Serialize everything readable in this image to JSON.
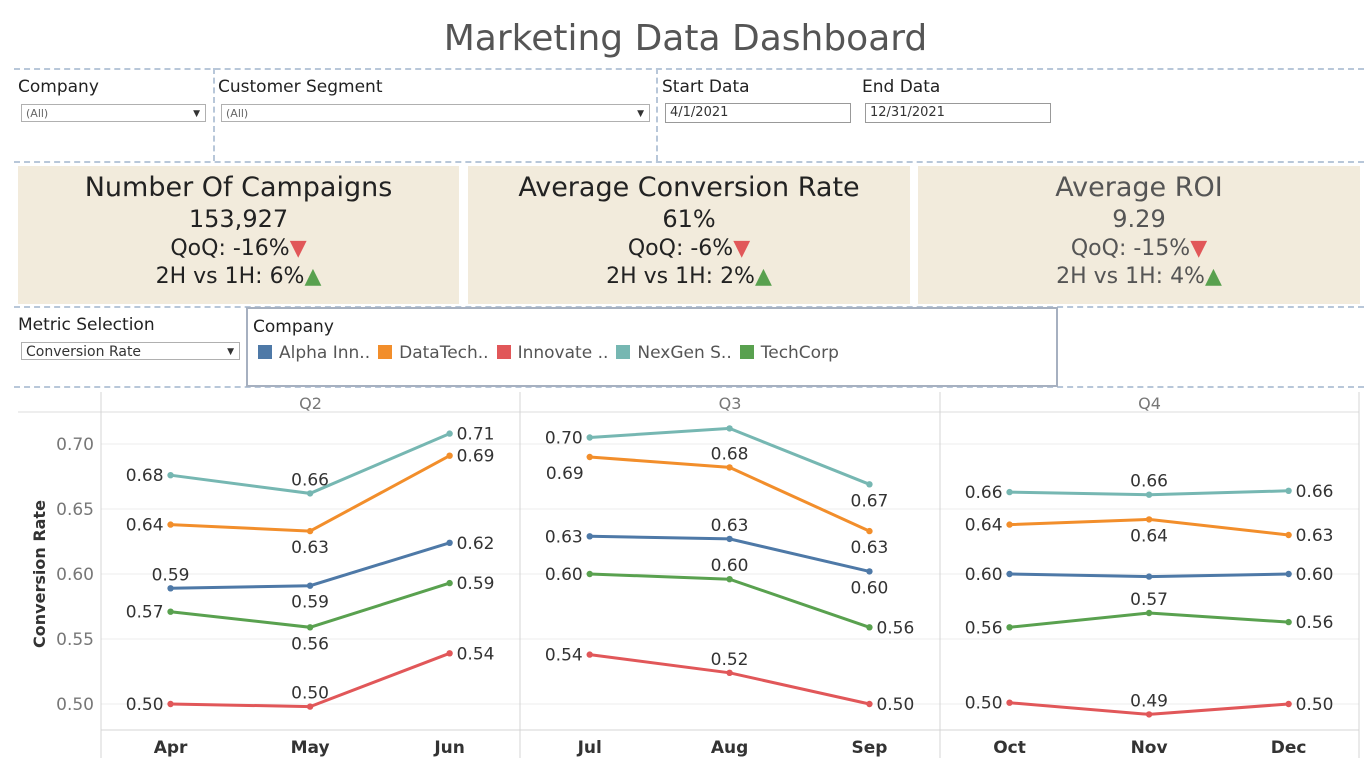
{
  "title": "Marketing Data Dashboard",
  "filters": {
    "company_label": "Company",
    "company_value": "(All)",
    "segment_label": "Customer Segment",
    "segment_value": "(All)",
    "start_label": "Start Data",
    "start_value": "4/1/2021",
    "end_label": "End Data",
    "end_value": "12/31/2021"
  },
  "kpis": [
    {
      "title": "Number Of Campaigns",
      "value": "153,927",
      "qoq": "QoQ: -16%",
      "qoq_dir": "down",
      "hvh": "2H vs 1H: 6%",
      "hvh_dir": "up"
    },
    {
      "title": "Average Conversion Rate",
      "value": "61%",
      "qoq": "QoQ: -6%",
      "qoq_dir": "down",
      "hvh": "2H vs 1H: 2%",
      "hvh_dir": "up"
    },
    {
      "title": "Average ROI",
      "value": "9.29",
      "qoq": "QoQ: -15%",
      "qoq_dir": "down",
      "hvh": "2H vs 1H: 4%",
      "hvh_dir": "up"
    }
  ],
  "metric": {
    "label": "Metric Selection",
    "value": "Conversion Rate"
  },
  "legend": {
    "title": "Company",
    "items": [
      {
        "label": "Alpha Inn..",
        "color": "#4e79a7"
      },
      {
        "label": "DataTech..",
        "color": "#f28e2b"
      },
      {
        "label": "Innovate ..",
        "color": "#e15759"
      },
      {
        "label": "NexGen S..",
        "color": "#76b7b2"
      },
      {
        "label": "TechCorp",
        "color": "#59a14f"
      }
    ]
  },
  "colors": {
    "down": "#e15759",
    "up": "#59a14f",
    "kpi_bg": "#f2ebdc"
  },
  "chart_data": {
    "type": "line",
    "ylabel": "Conversion Rate",
    "ylim": [
      0.48,
      0.72
    ],
    "yticks": [
      "0.50",
      "0.55",
      "0.60",
      "0.65",
      "0.70"
    ],
    "grid": true,
    "panels": [
      {
        "label": "Q2",
        "months": [
          "Apr",
          "May",
          "Jun"
        ]
      },
      {
        "label": "Q3",
        "months": [
          "Jul",
          "Aug",
          "Sep"
        ]
      },
      {
        "label": "Q4",
        "months": [
          "Oct",
          "Nov",
          "Dec"
        ]
      }
    ],
    "series": [
      {
        "name": "Alpha Inn..",
        "color": "#4e79a7",
        "values": [
          0.589,
          0.591,
          0.624,
          0.629,
          0.627,
          0.602,
          0.6,
          0.598,
          0.6
        ],
        "labels": [
          "0.59",
          "0.59",
          "0.62",
          "0.63",
          "0.63",
          "0.60",
          "0.60",
          "",
          "0.60"
        ],
        "pos": [
          "a",
          "b",
          "r",
          "l",
          "a",
          "b",
          "l",
          "",
          "r"
        ]
      },
      {
        "name": "DataTech..",
        "color": "#f28e2b",
        "values": [
          0.638,
          0.633,
          0.691,
          0.69,
          0.682,
          0.633,
          0.638,
          0.642,
          0.63
        ],
        "labels": [
          "0.64",
          "0.63",
          "0.69",
          "0.69",
          "0.68",
          "0.63",
          "0.64",
          "0.64",
          "0.63"
        ],
        "pos": [
          "l",
          "b",
          "r",
          "bl",
          "a",
          "b",
          "l",
          "b",
          "r"
        ]
      },
      {
        "name": "Innovate ..",
        "color": "#e15759",
        "values": [
          0.5,
          0.498,
          0.539,
          0.538,
          0.524,
          0.5,
          0.501,
          0.492,
          0.5
        ],
        "labels": [
          "0.50",
          "0.50",
          "0.54",
          "0.54",
          "0.52",
          "0.50",
          "0.50",
          "0.49",
          "0.50"
        ],
        "pos": [
          "l",
          "a",
          "r",
          "l",
          "a",
          "r",
          "l",
          "a",
          "r"
        ]
      },
      {
        "name": "NexGen S..",
        "color": "#76b7b2",
        "values": [
          0.676,
          0.662,
          0.708,
          0.705,
          0.712,
          0.669,
          0.663,
          0.661,
          0.664
        ],
        "labels": [
          "0.68",
          "0.66",
          "0.71",
          "0.70",
          "",
          "0.67",
          "0.66",
          "0.66",
          "0.66"
        ],
        "pos": [
          "l",
          "a",
          "r",
          "l",
          "",
          "b",
          "l",
          "a",
          "r"
        ]
      },
      {
        "name": "TechCorp",
        "color": "#59a14f",
        "values": [
          0.571,
          0.559,
          0.593,
          0.6,
          0.596,
          0.559,
          0.559,
          0.57,
          0.563
        ],
        "labels": [
          "0.57",
          "0.56",
          "0.59",
          "0.60",
          "0.60",
          "0.56",
          "0.56",
          "0.57",
          "0.56"
        ],
        "pos": [
          "l",
          "b",
          "r",
          "l",
          "a",
          "r",
          "l",
          "a",
          "r"
        ]
      }
    ]
  }
}
